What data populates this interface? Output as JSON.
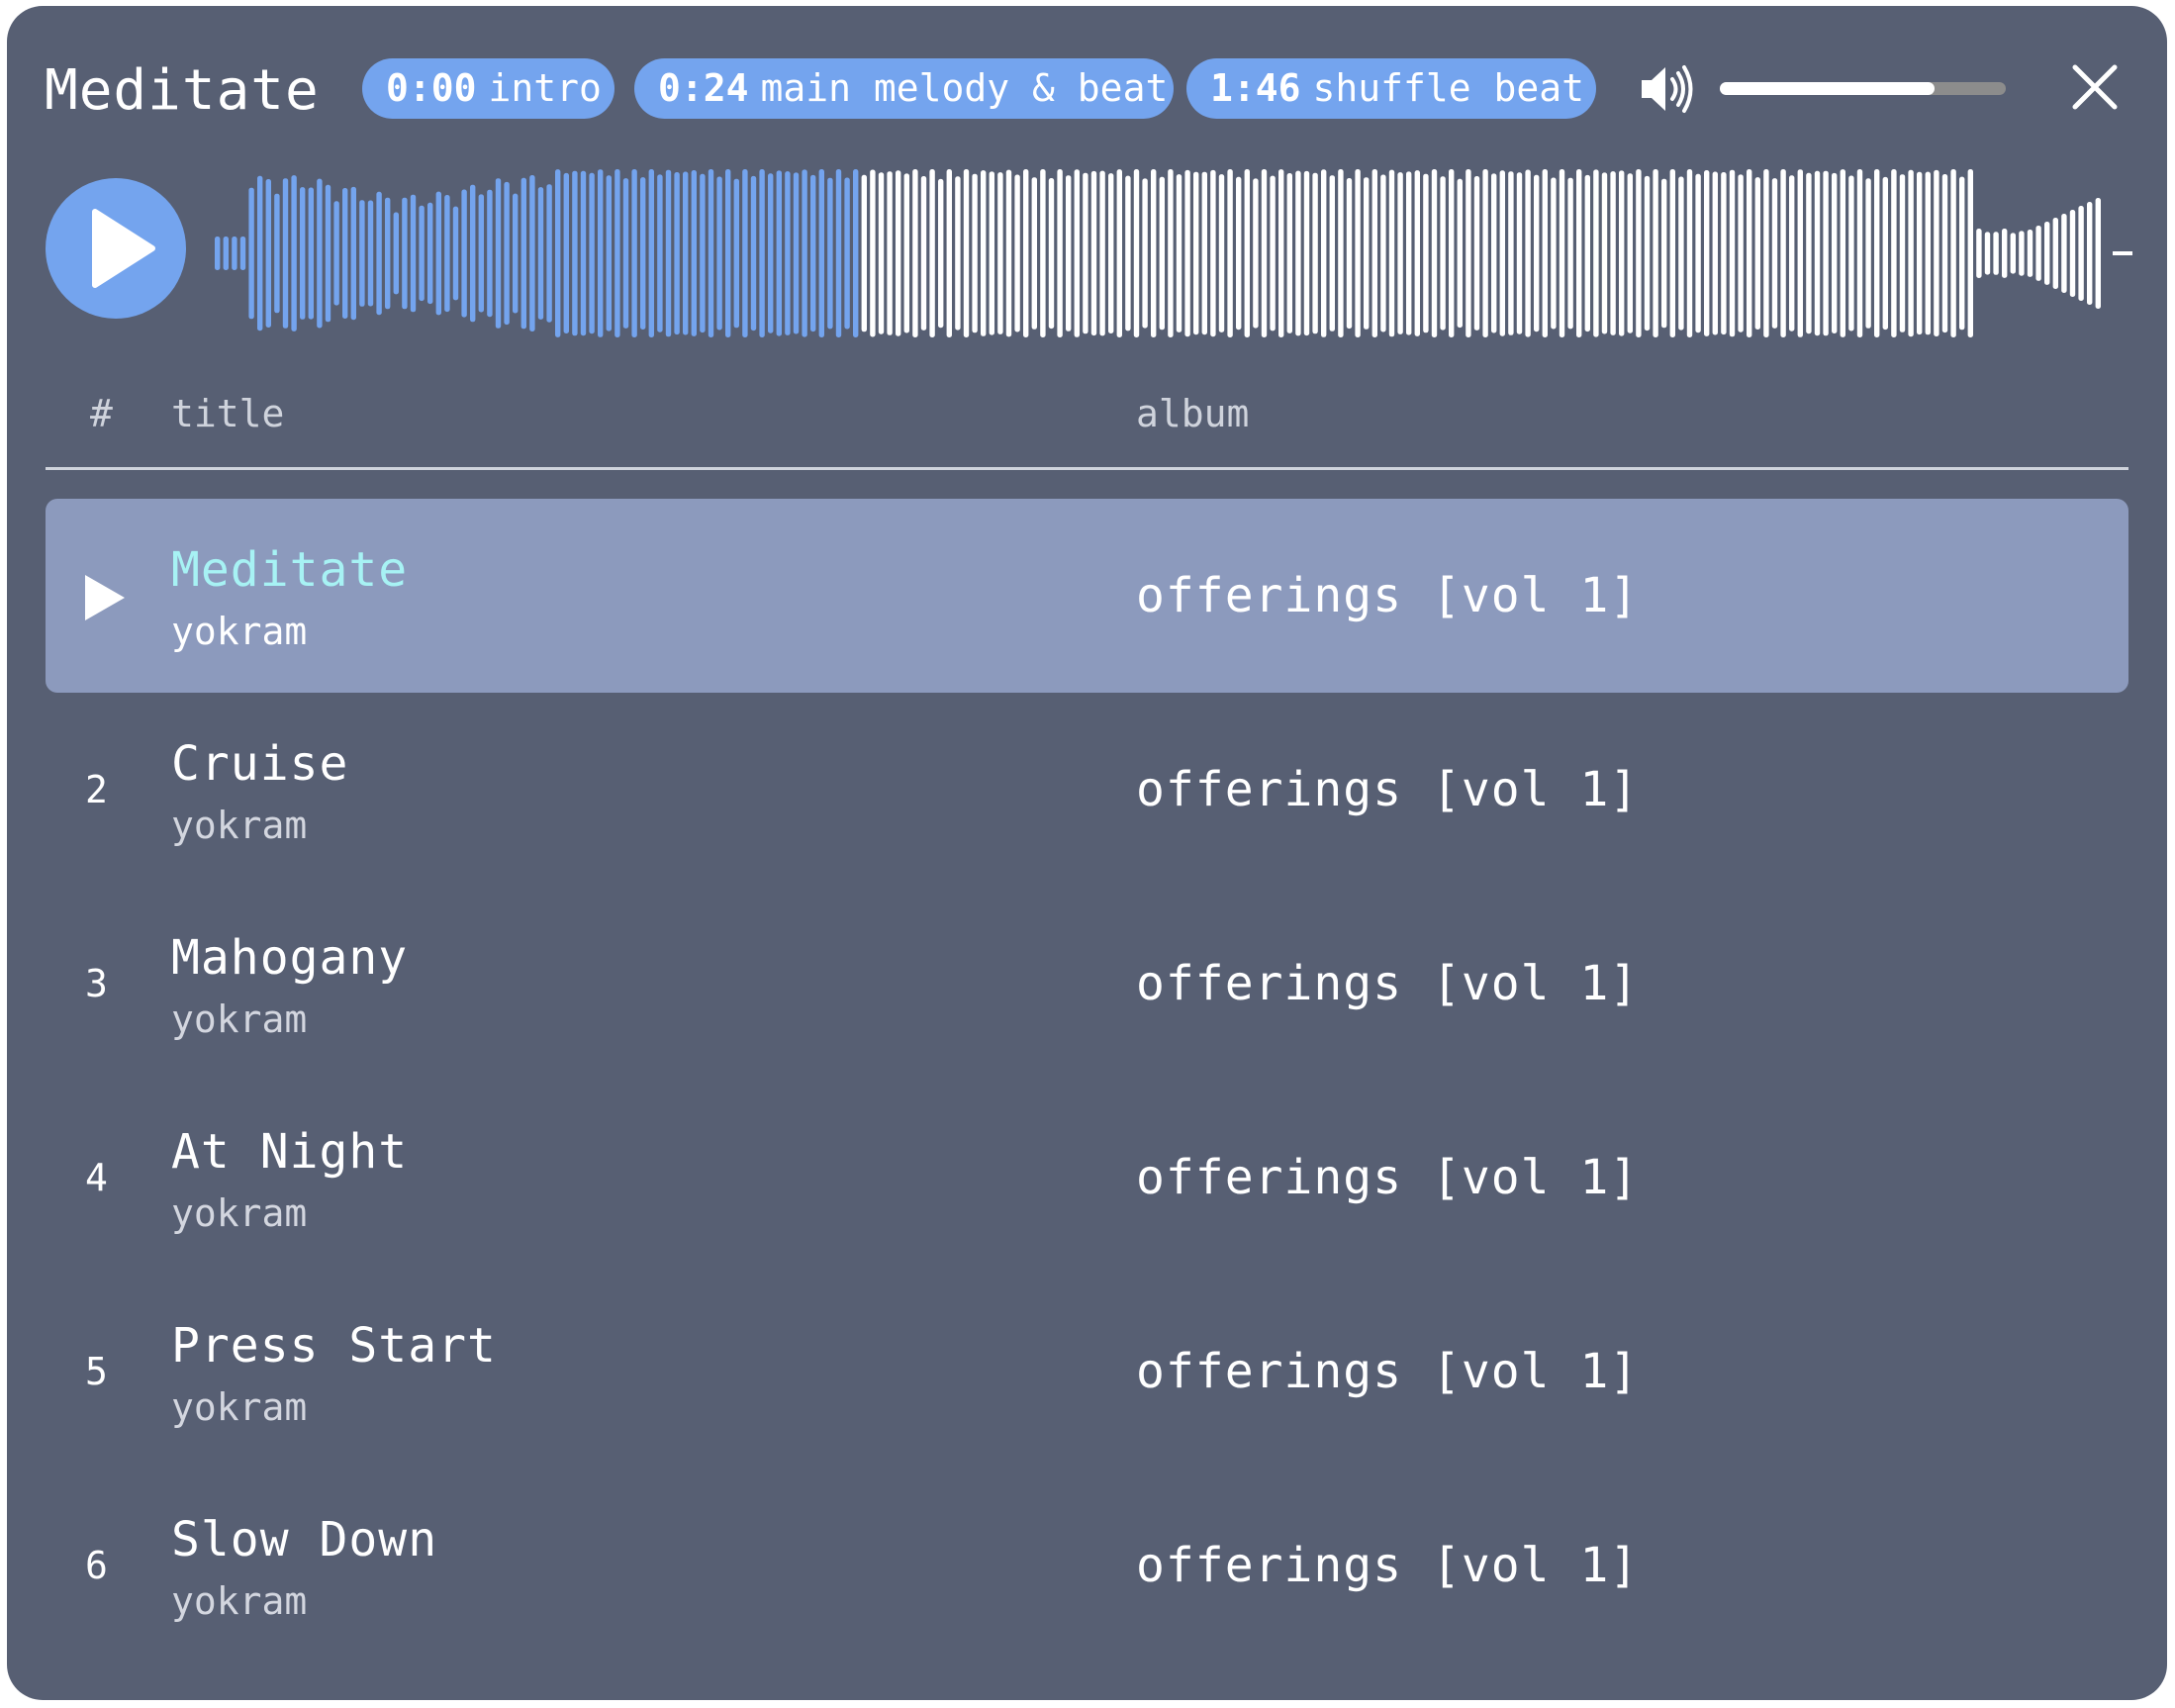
{
  "header": {
    "title": "Meditate",
    "chapters": [
      {
        "time": "0:00",
        "label": "intro"
      },
      {
        "time": "0:24",
        "label": "main melody & beat"
      },
      {
        "time": "1:46",
        "label": "shuffle beat"
      }
    ],
    "volume_level": 0.75,
    "volume_icon": "speaker-icon",
    "close_icon": "close-icon"
  },
  "player": {
    "play_icon": "play-icon",
    "progress": 0.34,
    "colors": {
      "played": "#74a4ee",
      "unplayed": "#ffffff",
      "background": "#575f73",
      "active_row": "#8c9abd",
      "active_title": "#a7f2f4"
    }
  },
  "table": {
    "columns": {
      "num": "#",
      "title": "title",
      "album": "album"
    },
    "rows": [
      {
        "num": "",
        "title": "Meditate",
        "artist": "yokram",
        "album": "offerings [vol 1]",
        "active": true
      },
      {
        "num": "2",
        "title": "Cruise",
        "artist": "yokram",
        "album": "offerings [vol 1]",
        "active": false
      },
      {
        "num": "3",
        "title": "Mahogany",
        "artist": "yokram",
        "album": "offerings [vol 1]",
        "active": false
      },
      {
        "num": "4",
        "title": "At Night",
        "artist": "yokram",
        "album": "offerings [vol 1]",
        "active": false
      },
      {
        "num": "5",
        "title": "Press Start",
        "artist": "yokram",
        "album": "offerings [vol 1]",
        "active": false
      },
      {
        "num": "6",
        "title": "Slow Down",
        "artist": "yokram",
        "album": "offerings [vol 1]",
        "active": false
      }
    ]
  }
}
